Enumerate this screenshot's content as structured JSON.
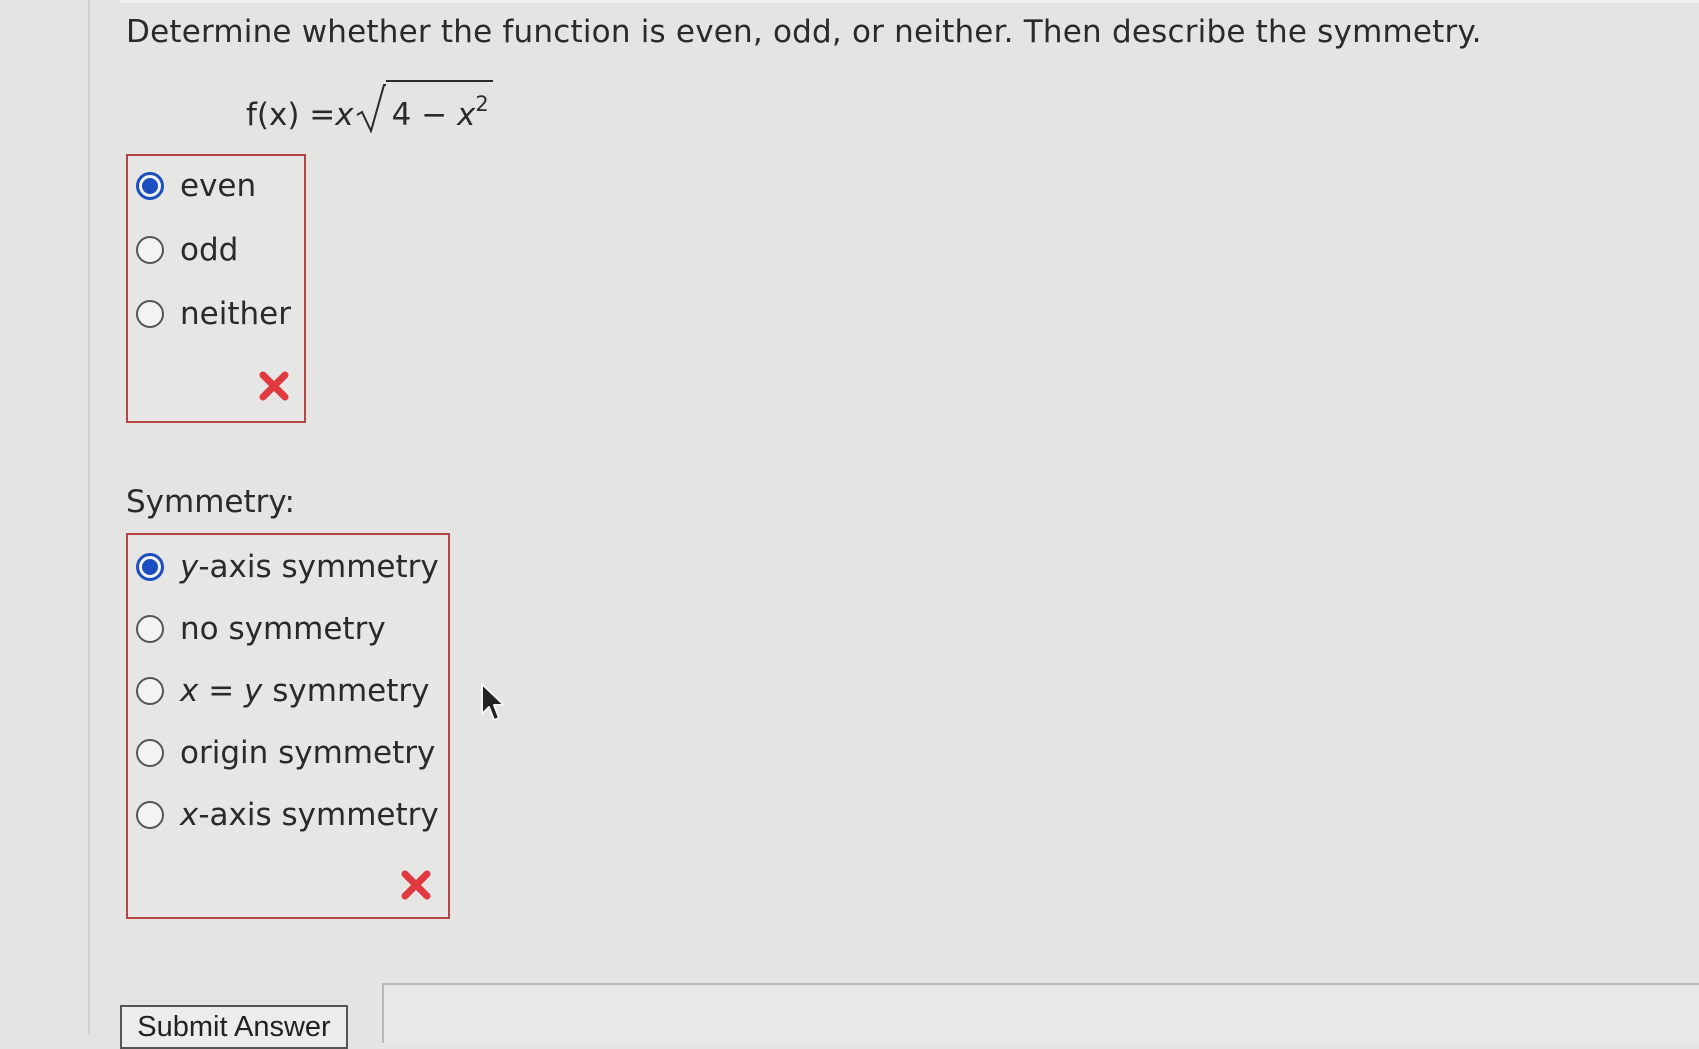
{
  "question": {
    "prompt": "Determine whether the function is even, odd, or neither. Then describe the symmetry.",
    "formula": {
      "lhs": "f(x) = ",
      "var": "x",
      "radicand_prefix": "4 − ",
      "radicand_var": "x",
      "exponent": "2"
    }
  },
  "parity": {
    "options": [
      {
        "label": "even",
        "selected": true
      },
      {
        "label": "odd",
        "selected": false
      },
      {
        "label": "neither",
        "selected": false
      }
    ],
    "result_icon": "incorrect-x-icon"
  },
  "symmetry": {
    "heading": "Symmetry:",
    "options": [
      {
        "label_var": "y",
        "label_rest": "-axis symmetry",
        "selected": true
      },
      {
        "label_var": "",
        "label_rest": "no symmetry",
        "selected": false
      },
      {
        "label_var": "x",
        "label_mid": " = ",
        "label_var2": "y",
        "label_rest": " symmetry",
        "selected": false
      },
      {
        "label_var": "",
        "label_rest": "origin symmetry",
        "selected": false
      },
      {
        "label_var": "x",
        "label_rest": "-axis symmetry",
        "selected": false
      }
    ],
    "result_icon": "incorrect-x-icon"
  },
  "submit": {
    "label": "Submit Answer"
  },
  "colors": {
    "incorrect": "#e0393f",
    "selected_radio": "#1b4fbf",
    "box_border": "#b74444"
  }
}
